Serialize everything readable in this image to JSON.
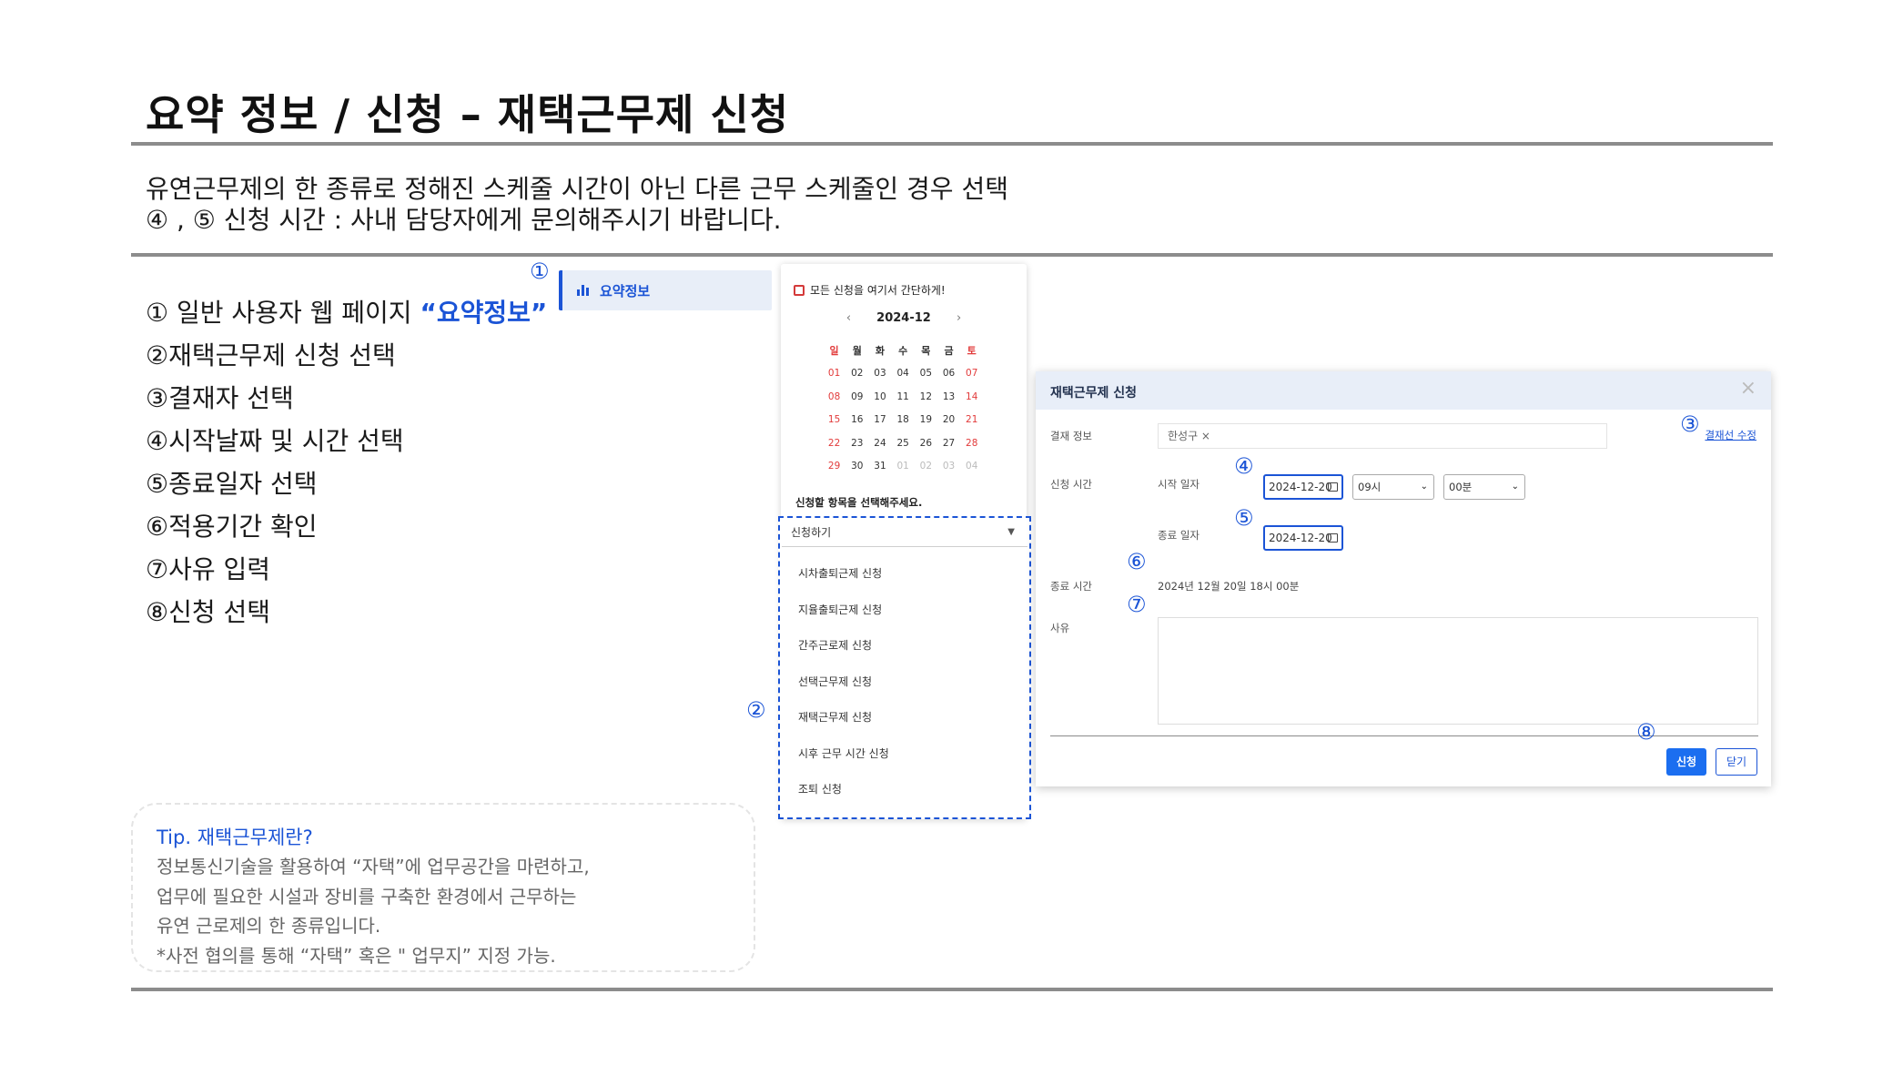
{
  "title": "요약 정보 / 신청 – 재택근무제 신청",
  "description": {
    "line1": "유연근무제의 한 종류로 정해진 스케줄 시간이 아닌 다른 근무 스케줄인 경우 선택",
    "line2": "④ , ⑤ 신청 시간 : 사내 담당자에게 문의해주시기 바랍니다."
  },
  "steps": [
    {
      "prefix": "① 일반 사용자 웹 페이지 ",
      "highlight": "“요약정보”"
    },
    {
      "text": "②재택근무제 신청 선택"
    },
    {
      "text": "③결재자 선택"
    },
    {
      "text": "④시작날짜 및 시간 선택"
    },
    {
      "text": "⑤종료일자 선택"
    },
    {
      "text": "⑥적용기간 확인"
    },
    {
      "text": "⑦사유 입력"
    },
    {
      "text": "⑧신청 선택"
    }
  ],
  "tip": {
    "title": "Tip. 재택근무제란?",
    "lines": [
      "정보통신기술을 활용하여 “자택”에 업무공간을 마련하고,",
      "업무에 필요한 시설과 장비를 구축한 환경에서 근무하는",
      "유연 근로제의 한 종류입니다.",
      "*사전 협의를 통해 “자택” 혹은 \" 업무지” 지정 가능."
    ]
  },
  "markers": [
    "①",
    "②",
    "③",
    "④",
    "⑤",
    "⑥",
    "⑦",
    "⑧"
  ],
  "sidebar": {
    "label": "요약정보",
    "icon": "bar-chart-icon"
  },
  "calendar": {
    "header": "모든 신청을 여기서 간단하게!",
    "month": "2024-12",
    "prev": "‹",
    "next": "›",
    "weekdays": [
      "일",
      "월",
      "화",
      "수",
      "목",
      "금",
      "토"
    ],
    "weeks": [
      [
        "01",
        "02",
        "03",
        "04",
        "05",
        "06",
        "07"
      ],
      [
        "08",
        "09",
        "10",
        "11",
        "12",
        "13",
        "14"
      ],
      [
        "15",
        "16",
        "17",
        "18",
        "19",
        "20",
        "21"
      ],
      [
        "22",
        "23",
        "24",
        "25",
        "26",
        "27",
        "28"
      ],
      [
        "29",
        "30",
        "31",
        "01",
        "02",
        "03",
        "04"
      ]
    ],
    "select_prompt": "신청할 항목을 선택해주세요."
  },
  "dropdown": {
    "selected": "신청하기",
    "options": [
      "시차출퇴근제 신청",
      "지율출퇴근제 신청",
      "간주근로제 신청",
      "선택근무제 신청",
      "재택근무제 신청",
      "시후 근무 시간 신청",
      "조퇴 신청"
    ]
  },
  "modal": {
    "title": "재택근무제 신청",
    "close": "×",
    "approver_label": "결재 정보",
    "approver_value": "한성구 ×",
    "approver_link": "결재선 수정",
    "time_label": "신청 시간",
    "start_label": "시작 일자",
    "start_date": "2024-12-20",
    "start_hour": "09시",
    "start_minute": "00분",
    "end_label": "종료 일자",
    "end_date": "2024-12-20",
    "end_time_label": "종료 시간",
    "end_time_value": "2024년 12월 20일 18시 00분",
    "reason_label": "사유",
    "submit": "신청",
    "cancel": "닫기"
  }
}
